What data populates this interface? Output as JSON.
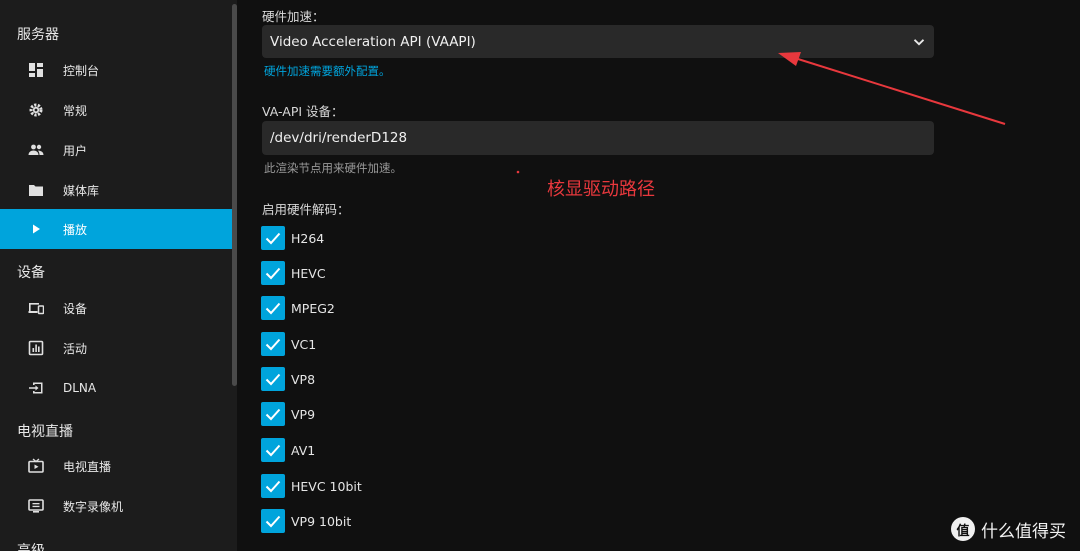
{
  "sidebar": {
    "sections": [
      {
        "title": "服务器",
        "items": [
          {
            "label": "控制台",
            "icon": "dashboard-icon"
          },
          {
            "label": "常规",
            "icon": "gear-icon"
          },
          {
            "label": "用户",
            "icon": "users-icon"
          },
          {
            "label": "媒体库",
            "icon": "folder-icon"
          },
          {
            "label": "播放",
            "icon": "play-icon",
            "active": true
          }
        ]
      },
      {
        "title": "设备",
        "items": [
          {
            "label": "设备",
            "icon": "devices-icon"
          },
          {
            "label": "活动",
            "icon": "activity-icon"
          },
          {
            "label": "DLNA",
            "icon": "input-icon"
          }
        ]
      },
      {
        "title": "电视直播",
        "items": [
          {
            "label": "电视直播",
            "icon": "live-tv-icon"
          },
          {
            "label": "数字录像机",
            "icon": "dvr-icon"
          }
        ]
      },
      {
        "title": "高级",
        "items": []
      }
    ]
  },
  "hw_accel": {
    "label": "硬件加速：",
    "value": "Video Acceleration API (VAAPI)",
    "help": "硬件加速需要额外配置。"
  },
  "vaapi_device": {
    "label": "VA-API 设备：",
    "value": "/dev/dri/renderD128",
    "help": "此渲染节点用来硬件加速。"
  },
  "decoding": {
    "label": "启用硬件解码：",
    "codecs": [
      {
        "label": "H264",
        "checked": true
      },
      {
        "label": "HEVC",
        "checked": true
      },
      {
        "label": "MPEG2",
        "checked": true
      },
      {
        "label": "VC1",
        "checked": true
      },
      {
        "label": "VP8",
        "checked": true
      },
      {
        "label": "VP9",
        "checked": true
      },
      {
        "label": "AV1",
        "checked": true
      },
      {
        "label": "HEVC 10bit",
        "checked": true
      },
      {
        "label": "VP9 10bit",
        "checked": true
      }
    ]
  },
  "annotation": {
    "text": "核显驱动路径",
    "color": "#e8383d"
  },
  "watermark": {
    "logo": "值",
    "text": "什么值得买"
  },
  "colors": {
    "accent": "#00a4dc",
    "background": "#101010",
    "sidebar": "#1c1c1c",
    "field": "#292929"
  }
}
